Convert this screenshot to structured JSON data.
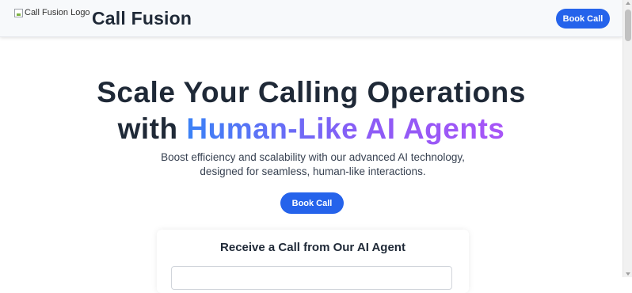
{
  "header": {
    "logo_alt": "Call Fusion Logo",
    "brand": "Call Fusion",
    "cta_label": "Book Call"
  },
  "hero": {
    "title_line1": "Scale Your Calling Operations",
    "title_line2_prefix": "with ",
    "title_line2_highlight": "Human-Like AI Agents",
    "subtitle": "Boost efficiency and scalability with our advanced AI technology, designed for seamless, human-like interactions.",
    "cta_label": "Book Call"
  },
  "card": {
    "title": "Receive a Call from Our AI Agent"
  },
  "colors": {
    "accent": "#2563eb",
    "gradient_start": "#3b82f6",
    "gradient_end": "#a855f7",
    "text_dark": "#1f2937"
  }
}
